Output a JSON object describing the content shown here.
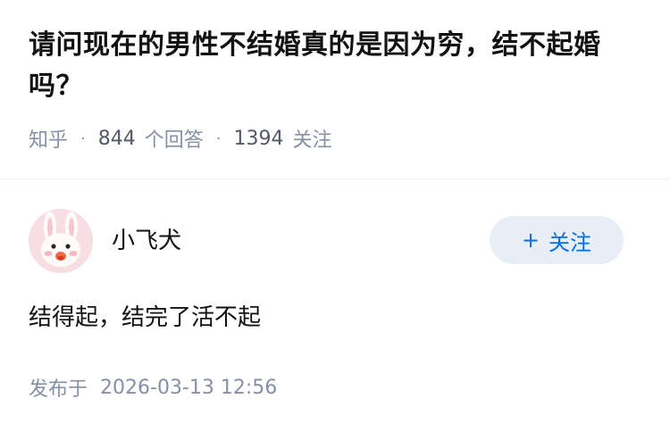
{
  "question": {
    "title": "请问现在的男性不结婚真的是因为穷，结不起婚吗？",
    "source": "知乎",
    "separator": "·",
    "answers_count": "844",
    "answers_label": "个回答",
    "followers_count": "1394",
    "followers_label": "关注"
  },
  "author": {
    "name": "小飞犬",
    "avatar_icon": "bunny-avatar-icon",
    "follow_plus": "+",
    "follow_label": "关注"
  },
  "answer": {
    "content": "结得起，结完了活不起",
    "published_label": "发布于",
    "published_time": "2026-03-13 12:56"
  },
  "colors": {
    "accent": "#056de8",
    "button_bg": "#e8eef6",
    "meta_text": "#8590a6",
    "primary_text": "#121212"
  }
}
